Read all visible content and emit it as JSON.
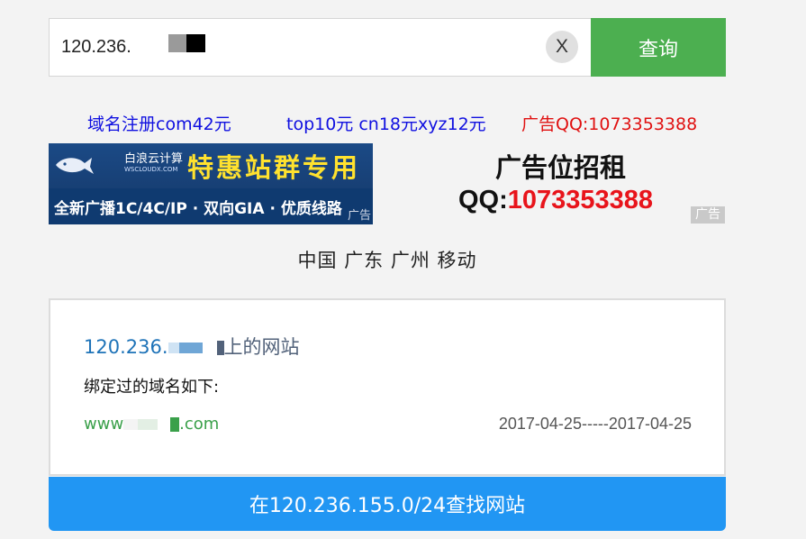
{
  "search": {
    "value": "120.236.",
    "clear_label": "X",
    "submit_label": "查询"
  },
  "ads": {
    "links": [
      {
        "text": "域名注册com42元",
        "color": "#1010e0"
      },
      {
        "text": "top10元 cn18元xyz12元",
        "color": "#1010e0"
      },
      {
        "text": "广告QQ:1073353388",
        "color": "#e01010"
      }
    ],
    "banner_left": {
      "brand": "白浪云计算",
      "brand_sub": "WSCLOUDX.COM",
      "headline": "特惠站群专用",
      "tagline": "全新广播1C/4C/IP · 双向GIA · 优质线路",
      "ad_tag": "广告"
    },
    "banner_right": {
      "title": "广告位招租",
      "qq_label": "QQ:",
      "qq_number": "1073353388",
      "ad_tag": "广告"
    }
  },
  "location": "中国 广东 广州 移动",
  "result": {
    "title_prefix": "120.236.",
    "title_suffix": "上的网站",
    "subtitle": "绑定过的域名如下:",
    "domains": [
      {
        "prefix": "www",
        "suffix": ".com",
        "date_range": "2017-04-25-----2017-04-25"
      }
    ]
  },
  "find_button": "在120.236.155.0/24查找网站",
  "colors": {
    "query_button": "#4caf50",
    "find_button": "#2196f3",
    "domain_link": "#3aa04a",
    "result_title": "#1e73b8"
  }
}
